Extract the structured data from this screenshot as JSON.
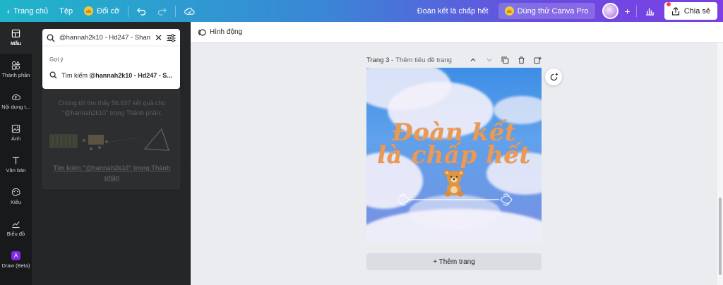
{
  "topbar": {
    "home_label": "Trang chủ",
    "file_label": "Tệp",
    "resize_label": "Đổi cỡ",
    "doc_title": "Đoàn kết là chấp hết",
    "pro_label": "Dùng thử Canva Pro",
    "share_label": "Chia sẻ"
  },
  "rail": {
    "items": [
      {
        "label": "Mẫu",
        "icon": "template-icon"
      },
      {
        "label": "Thành phần",
        "icon": "elements-icon"
      },
      {
        "label": "Nội dung t...",
        "icon": "upload-icon"
      },
      {
        "label": "Ảnh",
        "icon": "photo-icon"
      },
      {
        "label": "Văn bản",
        "icon": "text-icon"
      },
      {
        "label": "Kiểu",
        "icon": "styles-icon"
      },
      {
        "label": "Biểu đồ",
        "icon": "chart-icon"
      },
      {
        "label": "Draw (Beta)",
        "icon": "draw-icon"
      }
    ]
  },
  "panel": {
    "search_value": "@hannah2k10 - Hd247 - Shan",
    "suggest_heading": "Gợi ý",
    "suggest_prefix": "Tìm kiếm ",
    "suggest_bold": "@hannah2k10 - Hd247 - S...",
    "result_text": "Chúng tôi tìm thấy 56.637 kết quả cho \"@hannah2k10\" trong Thành phần:",
    "result_link": "Tìm kiếm \"@hannah2k10\" trong Thành phần"
  },
  "editor": {
    "animate_label": "Hình động",
    "page_label": "Trang 3 -",
    "page_subtitle": "Thêm tiêu đề trang",
    "title_line1": "Đoàn kết",
    "title_line2": "là chấp hết",
    "add_page_label": "+ Thêm trang"
  },
  "colors": {
    "accent_purple": "#7d2ae8",
    "title_orange": "#e89a57",
    "sky_blue": "#5fa1ec"
  }
}
